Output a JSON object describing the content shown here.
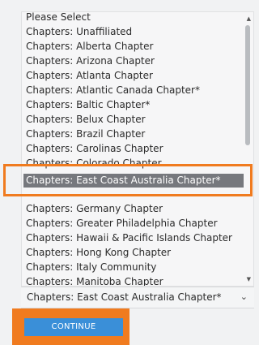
{
  "listbox": {
    "options": [
      "Please Select",
      "Chapters: Unaffiliated",
      "Chapters: Alberta Chapter",
      "Chapters: Arizona Chapter",
      "Chapters: Atlanta Chapter",
      "Chapters: Atlantic Canada Chapter*",
      "Chapters: Baltic Chapter*",
      "Chapters: Belux Chapter",
      "Chapters: Brazil Chapter",
      "Chapters: Carolinas Chapter",
      "Chapters: Colorado Chapter",
      "",
      "Chapters: East Coast Australia Chapter*",
      "",
      "Chapters: Germany Chapter",
      "Chapters: Greater Philadelphia Chapter",
      "Chapters: Hawaii & Pacific Islands Chapter",
      "Chapters: Hong Kong Chapter",
      "Chapters: Italy Community",
      "Chapters: Manitoba Chapter"
    ],
    "highlighted": "Chapters: East Coast Australia Chapter*"
  },
  "select": {
    "value": "Chapters: East Coast Australia Chapter*"
  },
  "continue_button": {
    "label": "CONTINUE"
  },
  "colors": {
    "highlight": "#76787d",
    "orange": "#f07b1f",
    "button": "#3a8fd8"
  }
}
